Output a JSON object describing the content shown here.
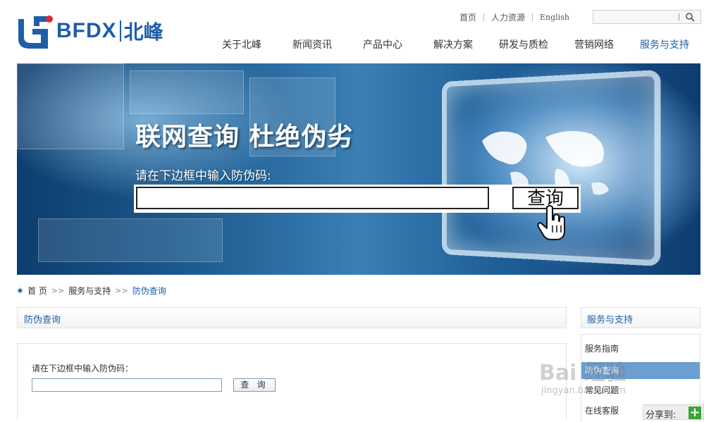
{
  "logo": {
    "text": "BFDX",
    "cn": "北峰"
  },
  "toplinks": [
    "首页",
    "人力资源",
    "English"
  ],
  "search": {
    "placeholder": ""
  },
  "nav": [
    "关于北峰",
    "新闻资讯",
    "产品中心",
    "解决方案",
    "研发与质检",
    "营销网络",
    "服务与支持"
  ],
  "banner": {
    "title": "联网查询 杜绝伪劣",
    "subtitle": "请在下边框中输入防伪码:",
    "button": "查询"
  },
  "breadcrumb": [
    "首 页",
    "服务与支持",
    "防伪查询"
  ],
  "panel": {
    "title": "防伪查询",
    "label": "请在下边框中输入防伪码：",
    "button": "查 询"
  },
  "sidebar": {
    "title": "服务与支持",
    "items": [
      "服务指南",
      "防伪查询",
      "常见问题",
      "在线客服"
    ]
  },
  "watermark": {
    "main": "Bai 经验",
    "sub": "jingyan.baidu.com"
  },
  "share": {
    "label": "分享到:",
    "plus": "+"
  },
  "colors": {
    "brand": "#1d5ea8",
    "accent_red": "#e3262f",
    "sidebar_active": "#6a9fd0"
  }
}
